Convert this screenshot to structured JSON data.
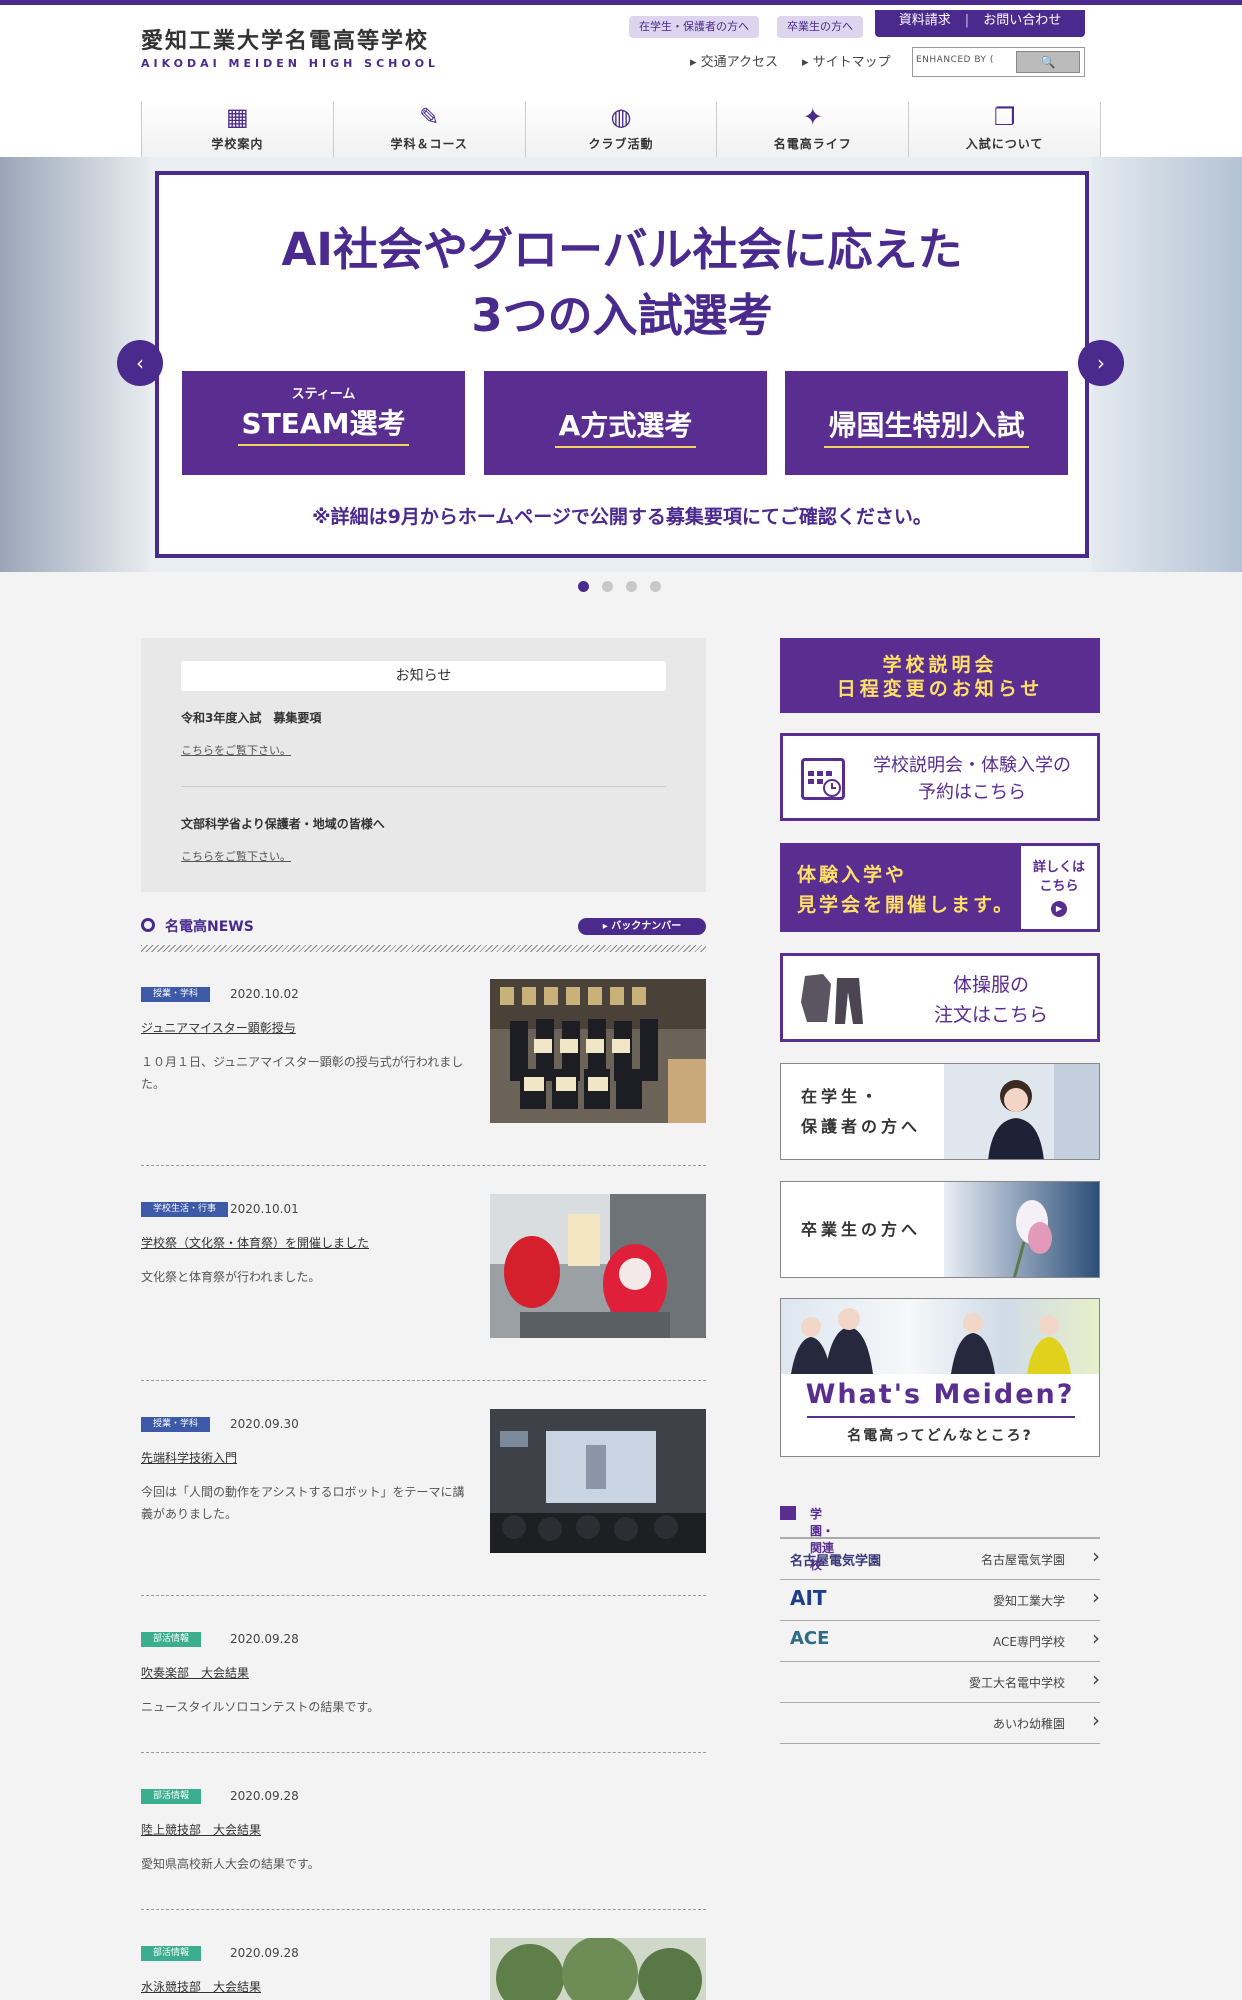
{
  "header": {
    "logo_jp": "愛知工業大学名電高等学校",
    "logo_en": "AIKODAI MEIDEN HIGH SCHOOL",
    "pill_students": "在学生・保護者の方へ",
    "pill_graduates": "卒業生の方へ",
    "util_request": "資料請求",
    "util_separator": "|",
    "util_contact": "お問い合わせ",
    "link_access": "交通アクセス",
    "link_sitemap": "サイトマップ",
    "search_placeholder": "ENHANCED BY ( ",
    "search_button": "🔍"
  },
  "nav": [
    {
      "label": "学校案内",
      "icon": "building-icon"
    },
    {
      "label": "学科＆コース",
      "icon": "pencil-icon"
    },
    {
      "label": "クラブ活動",
      "icon": "ball-icon"
    },
    {
      "label": "名電高ライフ",
      "icon": "sparkle-icon"
    },
    {
      "label": "入試について",
      "icon": "document-icon"
    }
  ],
  "hero": {
    "title_line1": "AI社会やグローバル社会に応えた",
    "title_line2": "3つの入試選考",
    "button1_ruby": "スティーム",
    "button1": "STEAM選考",
    "button2": "A方式選考",
    "button3": "帰国生特別入試",
    "note": "※詳細は9月からホームページで公開する募集要項にてご確認ください。",
    "prev": "‹",
    "next": "›",
    "slide_count": 4,
    "active_slide": 1
  },
  "notice": {
    "title": "お知らせ",
    "item1_text": "令和3年度入試　募集要項",
    "item1_link": "こちらをご覧下さい。",
    "item2_text": "文部科学省より保護者・地域の皆様へ",
    "item2_link": "こちらをご覧下さい。"
  },
  "news_section": {
    "title": "名電高NEWS",
    "backnumber": "▸ バックナンバー"
  },
  "news": [
    {
      "tag": "授業・学科",
      "date": "2020.10.02",
      "title": "ジュニアマイスター顕彰授与",
      "body": "１０月１日、ジュニアマイスター顕彰の授与式が行われました。"
    },
    {
      "tag": "学校生活・行事",
      "date": "2020.10.01",
      "title": "学校祭（文化祭・体育祭）を開催しました",
      "body": "文化祭と体育祭が行われました。"
    },
    {
      "tag": "授業・学科",
      "date": "2020.09.30",
      "title": "先端科学技術入門",
      "body": "今回は「人間の動作をアシストするロボット」をテーマに講義がありました。"
    },
    {
      "tag": "部活情報",
      "date": "2020.09.28",
      "title": "吹奏楽部　大会結果",
      "body": "ニュースタイルソロコンテストの結果です。"
    },
    {
      "tag": "部活情報",
      "date": "2020.09.28",
      "title": "陸上競技部　大会結果",
      "body": "愛知県高校新人大会の結果です。"
    },
    {
      "tag": "部活情報",
      "date": "2020.09.28",
      "title": "水泳競技部　大会結果",
      "body": ""
    }
  ],
  "side": {
    "sb1_line1": "学校説明会",
    "sb1_line2": "日程変更のお知らせ",
    "sb2_line1": "学校説明会・体験入学の",
    "sb2_line2": "予約はこちら",
    "sb3_line1": "体験入学や",
    "sb3_line2": "見学会を開催します。",
    "sb3_detail1": "詳しくは",
    "sb3_detail2": "こちら",
    "sb4_line1": "体操服の",
    "sb4_line2": "注文はこちら",
    "pb1_line1": "在学生・",
    "pb1_line2": "保護者の方へ",
    "pb2": "卒業生の方へ",
    "whats_title": "What's Meiden?",
    "whats_sub": "名電高ってどんなところ?",
    "related_title": "学園・関連校"
  },
  "related": [
    {
      "logo": "名古屋電気学園",
      "name": "名古屋電気学園"
    },
    {
      "logo": "AIT",
      "name": "愛知工業大学"
    },
    {
      "logo": "ACE",
      "name": "ACE専門学校"
    },
    {
      "logo": "",
      "name": "愛工大名電中学校"
    },
    {
      "logo": "",
      "name": "あいわ幼稚園"
    }
  ],
  "colors": {
    "brand": "#4b2a8e",
    "accent_yellow": "#ffe066",
    "tag_blue": "#3d5aa8",
    "tag_green": "#3aae8f"
  }
}
